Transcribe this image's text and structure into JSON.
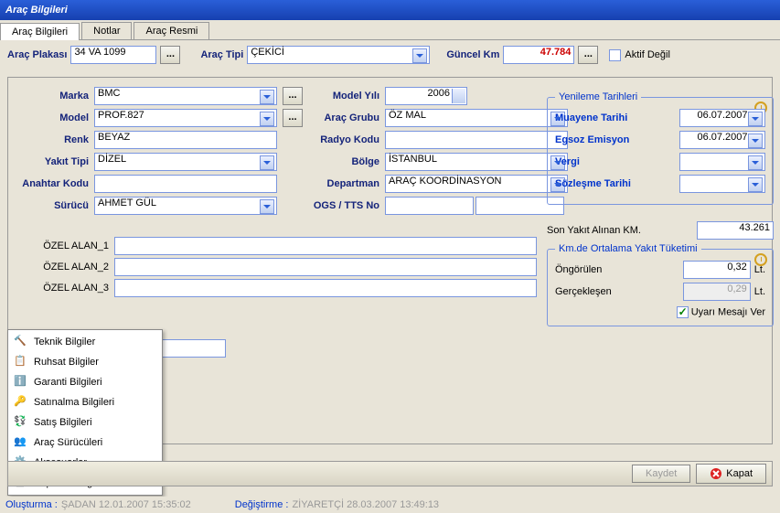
{
  "window_title": "Araç Bilgileri",
  "tabs": [
    "Araç Bilgileri",
    "Notlar",
    "Araç Resmi"
  ],
  "top": {
    "plaka_label": "Araç Plakası",
    "plaka_value": "34 VA 1099",
    "tipi_label": "Araç Tipi",
    "tipi_value": "ÇEKİCİ",
    "km_label": "Güncel Km",
    "km_value": "47.784",
    "aktif_label": "Aktif Değil"
  },
  "left": {
    "marka_label": "Marka",
    "marka": "BMC",
    "model_label": "Model",
    "model": "PROF.827",
    "renk_label": "Renk",
    "renk": "BEYAZ",
    "yakit_label": "Yakıt Tipi",
    "yakit": "DİZEL",
    "anahtar_label": "Anahtar Kodu",
    "anahtar": "",
    "surucu_label": "Sürücü",
    "surucu": "AHMET GÜL"
  },
  "mid": {
    "modelyili_label": "Model Yılı",
    "modelyili": "2006",
    "aracgrubu_label": "Araç Grubu",
    "aracgrubu": "ÖZ MAL",
    "radyo_label": "Radyo Kodu",
    "radyo": "",
    "bolge_label": "Bölge",
    "bolge": "İSTANBUL",
    "departman_label": "Departman",
    "departman": "ARAÇ KOORDİNASYON",
    "ogs_label": "OGS / TTS No",
    "ogs1": "",
    "ogs2": ""
  },
  "right": {
    "yenileme_title": "Yenileme Tarihleri",
    "muayene_label": "Muayene Tarihi",
    "muayene": "06.07.2007",
    "egzos_label": "Egsoz Emisyon",
    "egzos": "06.07.2007",
    "vergi_label": "Vergi",
    "vergi": "",
    "sozlesme_label": "Sözleşme Tarihi",
    "sozlesme": "",
    "sonyakit_label": "Son Yakıt Alınan KM.",
    "sonyakit": "43.261",
    "tuketim_title": "Km.de Ortalama Yakıt Tüketimi",
    "ongorulen_label": "Öngörülen",
    "ongorulen": "0,32",
    "unit": "Lt.",
    "gerceklesen_label": "Gerçekleşen",
    "gerceklesen": "0,29",
    "uyari_label": "Uyarı Mesajı Ver"
  },
  "ozel": {
    "a1_label": "ÖZEL ALAN_1",
    "a1": "",
    "a2_label": "ÖZEL ALAN_2",
    "a2": "",
    "a3_label": "ÖZEL ALAN_3",
    "a3": ""
  },
  "popup": {
    "items": [
      {
        "icon": "hammer",
        "label": "Teknik Bilgiler"
      },
      {
        "icon": "ruhsat",
        "label": "Ruhsat Bilgiler"
      },
      {
        "icon": "info",
        "label": "Garanti Bilgileri"
      },
      {
        "icon": "key",
        "label": "Satınalma Bilgileri"
      },
      {
        "icon": "satis",
        "label": "Satış Bilgileri"
      },
      {
        "icon": "users",
        "label": "Araç Sürücüleri"
      },
      {
        "icon": "gear",
        "label": "Aksesuarlar"
      },
      {
        "icon": "printer",
        "label": "Kapasite Bilgileri"
      }
    ]
  },
  "buttons": {
    "kaydet": "Kaydet",
    "kapat": "Kapat"
  },
  "status": {
    "olusturma_label": "Oluşturma :",
    "olusturma": "ŞADAN 12.01.2007 15:35:02",
    "degistirme_label": "Değiştirme :",
    "degistirme": "ZİYARETÇİ 28.03.2007 13:49:13"
  }
}
